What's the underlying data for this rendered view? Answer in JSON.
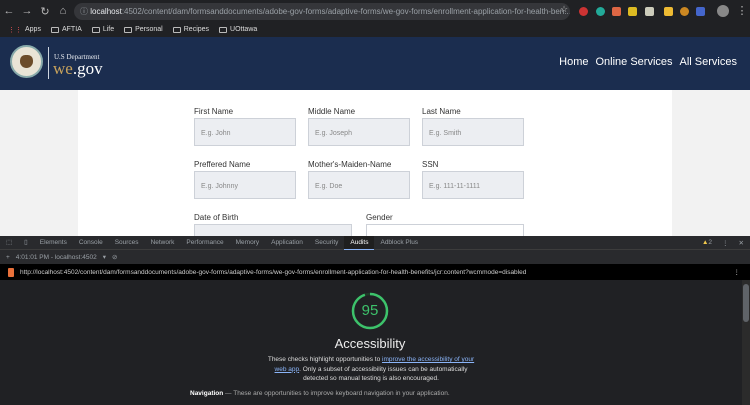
{
  "browser": {
    "url_host": "localhost",
    "url_rest": ":4502/content/dam/formsanddocuments/adobe-gov-forms/adaptive-forms/we-gov-forms/enrollment-application-for-health-ben...",
    "bookmarks": [
      "Apps",
      "AFTIA",
      "Life",
      "Personal",
      "Recipes",
      "UOttawa"
    ]
  },
  "site": {
    "dept": "U.S Department",
    "brand_we": "we",
    "brand_gov": ".gov",
    "nav": [
      "Home",
      "Online Services",
      "All Services"
    ]
  },
  "form": {
    "first_name": {
      "label": "First Name",
      "placeholder": "E.g. John"
    },
    "middle_name": {
      "label": "Middle Name",
      "placeholder": "E.g. Joseph"
    },
    "last_name": {
      "label": "Last Name",
      "placeholder": "E.g. Smith"
    },
    "preferred_name": {
      "label": "Preffered Name",
      "placeholder": "E.g. Johnny"
    },
    "maiden_name": {
      "label": "Mother's-Maiden-Name",
      "placeholder": "E.g. Doe"
    },
    "ssn": {
      "label": "SSN",
      "placeholder": "E.g. 111-11-1111"
    },
    "dob": {
      "label": "Date of Birth"
    },
    "gender": {
      "label": "Gender"
    }
  },
  "devtools": {
    "tabs": [
      "Elements",
      "Console",
      "Sources",
      "Network",
      "Performance",
      "Memory",
      "Application",
      "Security",
      "Audits",
      "Adblock Plus"
    ],
    "warnings": "2",
    "session": "4:01:01 PM - localhost:4502",
    "audit_url": "http://localhost:4502/content/dam/formsanddocuments/adobe-gov-forms/adaptive-forms/we-gov-forms/enrollment-application-for-health-benefits/jcr:content?wcmmode=disabled",
    "score": "95",
    "score_fraction": 0.95,
    "score_color": "#3dc26b",
    "category": "Accessibility",
    "desc_pre": "These checks highlight opportunities to ",
    "desc_link": "improve the accessibility of your web app",
    "desc_post": ". Only a subset of accessibility issues can be automatically detected so manual testing is also encouraged.",
    "nav_title": "Navigation",
    "nav_desc": " — These are opportunities to improve keyboard navigation in your application."
  }
}
